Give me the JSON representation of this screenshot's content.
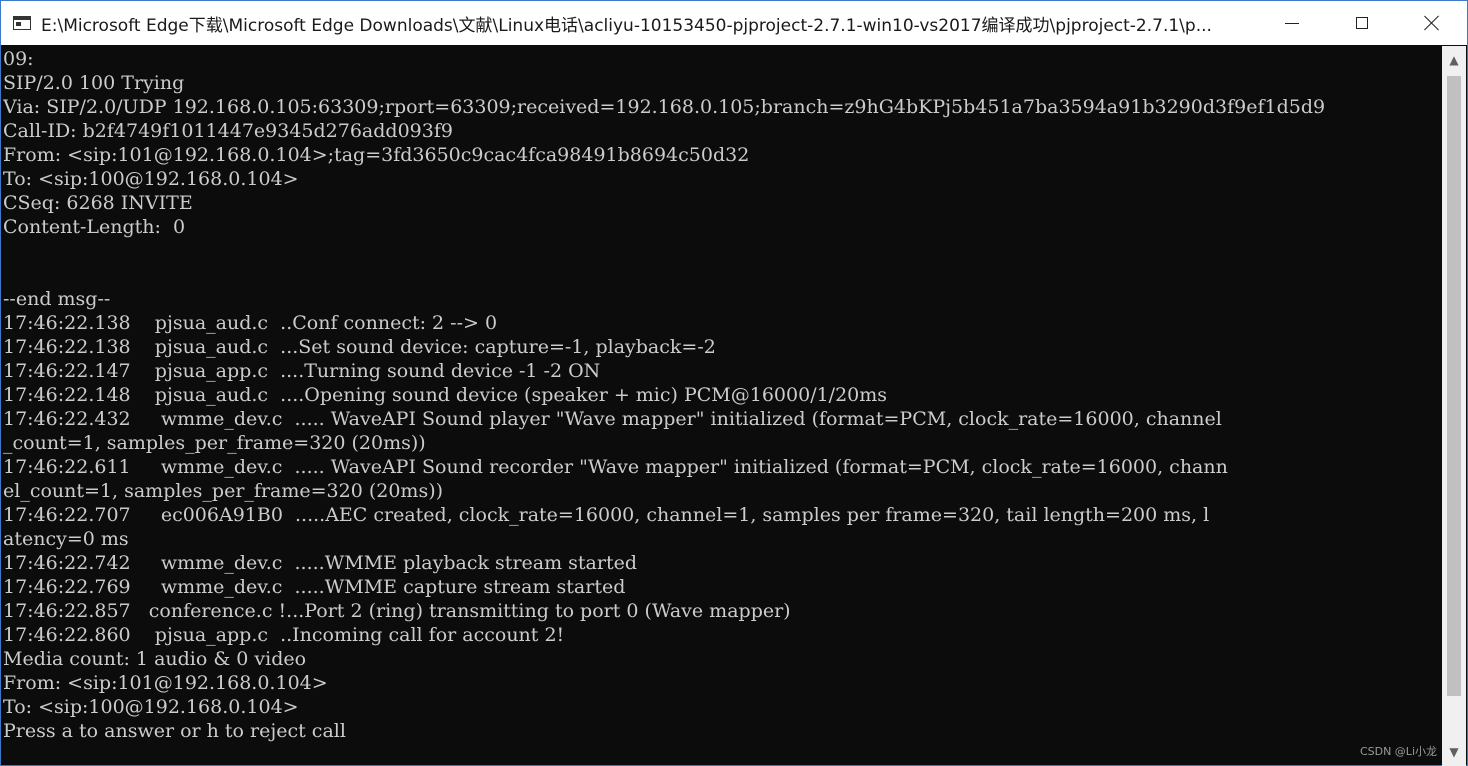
{
  "window": {
    "title": "E:\\Microsoft Edge下载\\Microsoft Edge Downloads\\文献\\Linux电话\\acliyu-10153450-pjproject-2.7.1-win10-vs2017编译成功\\pjproject-2.7.1\\p..."
  },
  "console": {
    "lines": [
      "09:",
      "SIP/2.0 100 Trying",
      "Via: SIP/2.0/UDP 192.168.0.105:63309;rport=63309;received=192.168.0.105;branch=z9hG4bKPj5b451a7ba3594a91b3290d3f9ef1d5d9",
      "Call-ID: b2f4749f1011447e9345d276add093f9",
      "From: <sip:101@192.168.0.104>;tag=3fd3650c9cac4fca98491b8694c50d32",
      "To: <sip:100@192.168.0.104>",
      "CSeq: 6268 INVITE",
      "Content-Length:  0",
      "",
      "",
      "--end msg--",
      "17:46:22.138    pjsua_aud.c  ..Conf connect: 2 --> 0",
      "17:46:22.138    pjsua_aud.c  ...Set sound device: capture=-1, playback=-2",
      "17:46:22.147    pjsua_app.c  ....Turning sound device -1 -2 ON",
      "17:46:22.148    pjsua_aud.c  ....Opening sound device (speaker + mic) PCM@16000/1/20ms",
      "17:46:22.432     wmme_dev.c  ..... WaveAPI Sound player \"Wave mapper\" initialized (format=PCM, clock_rate=16000, channel",
      "_count=1, samples_per_frame=320 (20ms))",
      "17:46:22.611     wmme_dev.c  ..... WaveAPI Sound recorder \"Wave mapper\" initialized (format=PCM, clock_rate=16000, chann",
      "el_count=1, samples_per_frame=320 (20ms))",
      "17:46:22.707     ec006A91B0  .....AEC created, clock_rate=16000, channel=1, samples per frame=320, tail length=200 ms, l",
      "atency=0 ms",
      "17:46:22.742     wmme_dev.c  .....WMME playback stream started",
      "17:46:22.769     wmme_dev.c  .....WMME capture stream started",
      "17:46:22.857   conference.c !...Port 2 (ring) transmitting to port 0 (Wave mapper)",
      "17:46:22.860    pjsua_app.c  ..Incoming call for account 2!",
      "Media count: 1 audio & 0 video",
      "From: <sip:101@192.168.0.104>",
      "To: <sip:100@192.168.0.104>",
      "Press a to answer or h to reject call"
    ]
  },
  "watermark": "CSDN @Li小龙",
  "colors": {
    "console_bg": "#0c0c0c",
    "console_fg": "#cccccc",
    "titlebar_bg": "#ffffff",
    "window_border": "#3c78c8"
  }
}
